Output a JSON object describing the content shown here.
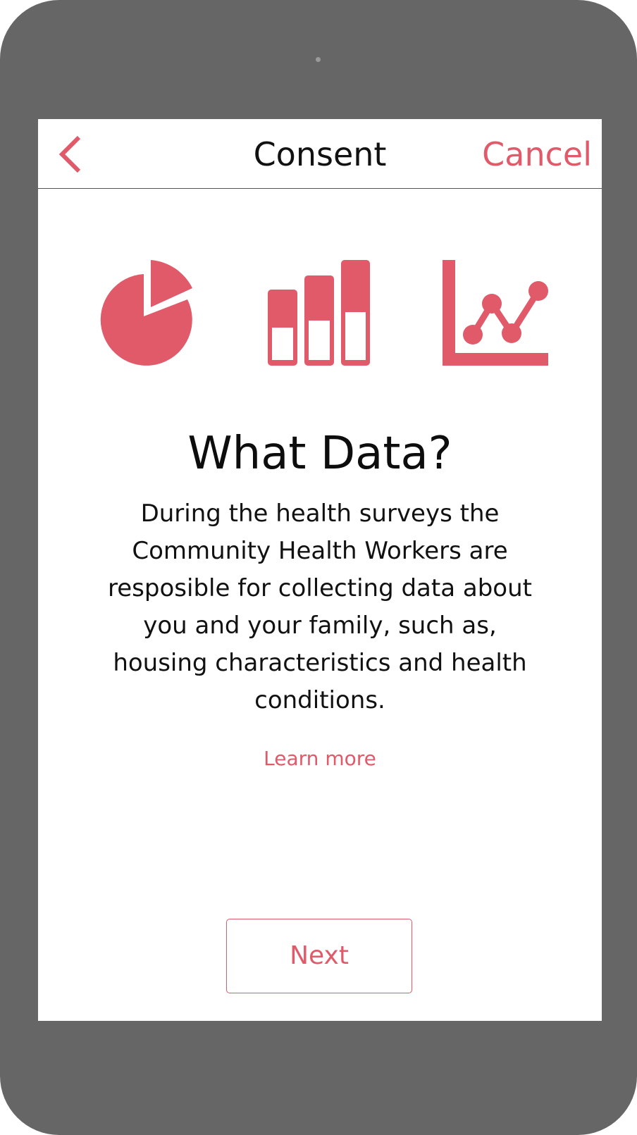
{
  "navbar": {
    "back_icon": "chevron-left-icon",
    "title": "Consent",
    "cancel_label": "Cancel"
  },
  "illustration": {
    "icons": [
      "pie-chart-icon",
      "bar-chart-icon",
      "line-chart-icon"
    ],
    "accent_color": "#e05a6a"
  },
  "content": {
    "heading": "What Data?",
    "body": "During the health surveys the Community Health Workers are resposible for collecting data about you and your family, such as, housing characteristics and health conditions.",
    "learn_more_label": "Learn more"
  },
  "footer": {
    "next_label": "Next"
  },
  "colors": {
    "accent": "#e05a6a",
    "device_frame": "#666666",
    "text": "#111111"
  }
}
